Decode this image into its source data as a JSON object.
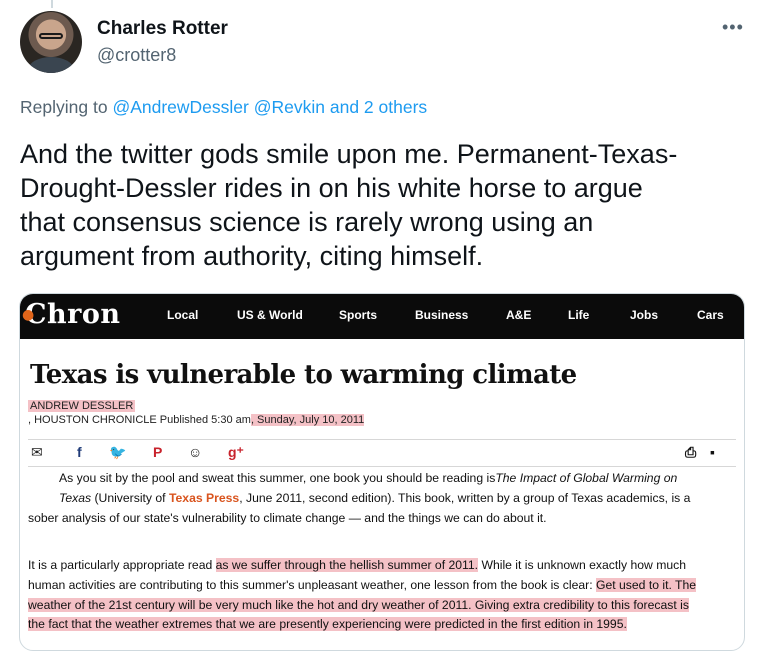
{
  "tweet": {
    "author_name": "Charles Rotter",
    "author_handle": "@crotter8",
    "more_icon": "more-horizontal-icon",
    "reply_prefix": "Replying to",
    "reply_mention_1": "@AndrewDessler",
    "reply_mention_2": "@Revkin",
    "reply_others": "and 2 others",
    "text_lines": [
      "And the twitter gods smile upon me.  Permanent-Texas-",
      "Drought-Dessler rides in on his white horse to argue",
      "that consensus science is rarely wrong using an",
      "argument from authority, citing himself."
    ]
  },
  "article": {
    "site_logo": "Chron",
    "nav": [
      "Local",
      "US & World",
      "Sports",
      "Business",
      "A&E",
      "Life",
      "Jobs",
      "Cars"
    ],
    "title": "Texas is vulnerable to warming climate",
    "byline": "ANDREW DESSLER",
    "pub_prefix": ", HOUSTON CHRONICLE   Published 5:30 am",
    "pub_date": ", Sunday, July 10, 2011",
    "share_icons": [
      "email-icon",
      "facebook-icon",
      "twitter-icon",
      "pinterest-icon",
      "reddit-icon",
      "google-plus-icon",
      "print-icon",
      "comment-icon"
    ],
    "para1": {
      "l1_a": "As you sit by the pool and sweat this summer, one book you should be reading is",
      "l1_b": "The Impact of Global Warming on",
      "l2_a": "Texas",
      "l2_b": " (University of ",
      "l2_c": "Texas Press",
      "l2_d": ", June 2011, second edition). This book, written by a group of Texas academics, is a",
      "l3": "sober analysis of our state's vulnerability to climate change — and the things we can do about it."
    },
    "para2": {
      "l1_a": "It is a particularly appropriate read ",
      "l1_b": "as we suffer through the hellish summer of 2011.",
      "l1_c": " While it is unknown exactly how much",
      "l2_a": "human activities are contributing to this summer's unpleasant weather, one lesson from the book is clear: ",
      "l2_b": "Get used to it. The",
      "l3": "weather of the 21st century will be very much like the hot and dry weather of 2011. Giving extra credibility to this forecast is",
      "l4": "the fact that the weather extremes that we are presently experiencing were predicted in the first edition in 1995."
    }
  }
}
